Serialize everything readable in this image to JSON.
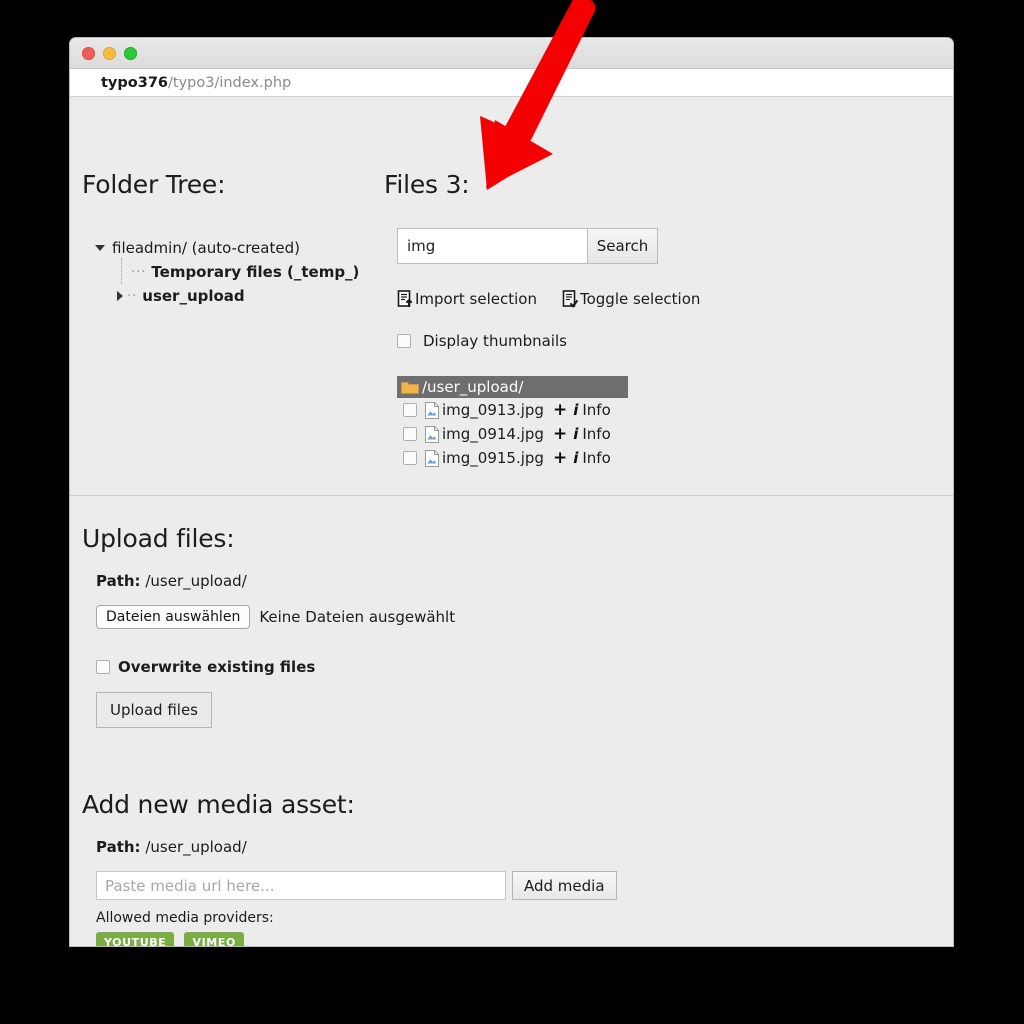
{
  "window": {
    "traffic_lights": [
      "close",
      "minimize",
      "maximize"
    ],
    "url_host": "typo376",
    "url_path": "/typo3/index.php"
  },
  "folder_tree": {
    "heading": "Folder Tree:",
    "items": [
      {
        "label": "fileadmin/ (auto-created)",
        "bold": false,
        "caret": "down"
      },
      {
        "label": "Temporary files (_temp_)",
        "bold": true,
        "caret": "none"
      },
      {
        "label": "user_upload",
        "bold": true,
        "caret": "right"
      }
    ]
  },
  "files": {
    "heading": "Files 3:",
    "search": {
      "value": "img",
      "placeholder": "",
      "button": "Search"
    },
    "actions": [
      {
        "label": "Import selection",
        "icon": "import-icon"
      },
      {
        "label": "Toggle selection",
        "icon": "toggle-icon"
      }
    ],
    "display_thumbnails": {
      "label": "Display thumbnails",
      "checked": false
    },
    "folder_bar": "/user_upload/",
    "rows": [
      {
        "name": "img_0913.jpg",
        "plus": "+",
        "info": "Info",
        "checked": false
      },
      {
        "name": "img_0914.jpg",
        "plus": "+",
        "info": "Info",
        "checked": false
      },
      {
        "name": "img_0915.jpg",
        "plus": "+",
        "info": "Info",
        "checked": false
      }
    ]
  },
  "upload": {
    "heading": "Upload files:",
    "path_label": "Path:",
    "path_value": "/user_upload/",
    "choose_button": "Dateien auswählen",
    "choose_status": "Keine Dateien ausgewählt",
    "overwrite_label": "Overwrite existing files",
    "overwrite_checked": false,
    "submit_button": "Upload files"
  },
  "media": {
    "heading": "Add new media asset:",
    "path_label": "Path:",
    "path_value": "/user_upload/",
    "input_placeholder": "Paste media url here...",
    "input_value": "",
    "add_button": "Add media",
    "providers_label": "Allowed media providers:",
    "providers": [
      "YOUTUBE",
      "VIMEO"
    ]
  },
  "annotation": {
    "type": "arrow",
    "color": "#f40000",
    "points_to": "search-input"
  }
}
